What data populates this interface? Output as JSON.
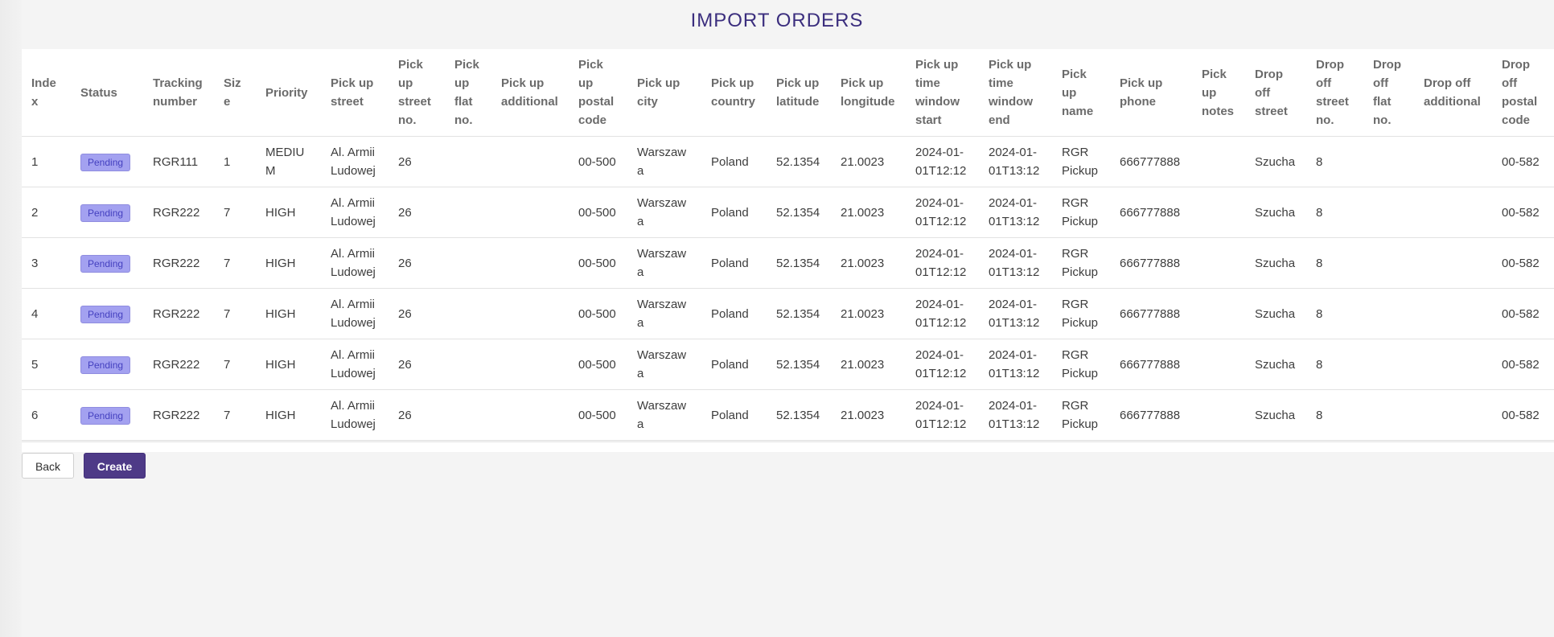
{
  "page": {
    "title": "IMPORT ORDERS"
  },
  "table": {
    "headers": [
      "Index",
      "Status",
      "Tracking number",
      "Size",
      "Priority",
      "Pick up street",
      "Pick up street no.",
      "Pick up flat no.",
      "Pick up additional",
      "Pick up postal code",
      "Pick up city",
      "Pick up country",
      "Pick up latitude",
      "Pick up longitude",
      "Pick up time window start",
      "Pick up time window end",
      "Pick up name",
      "Pick up phone",
      "Pick up notes",
      "Drop off street",
      "Drop off street no.",
      "Drop off flat no.",
      "Drop off additional",
      "Drop off postal code"
    ],
    "rows": [
      [
        "1",
        "Pending",
        "RGR111",
        "1",
        "MEDIUM",
        "Al. Armii Ludowej",
        "26",
        "",
        "",
        "00-500",
        "Warszawa",
        "Poland",
        "52.1354",
        "21.0023",
        "2024-01-01T12:12",
        "2024-01-01T13:12",
        "RGR Pickup",
        "666777888",
        "",
        "Szucha",
        "8",
        "",
        "",
        "00-582"
      ],
      [
        "2",
        "Pending",
        "RGR222",
        "7",
        "HIGH",
        "Al. Armii Ludowej",
        "26",
        "",
        "",
        "00-500",
        "Warszawa",
        "Poland",
        "52.1354",
        "21.0023",
        "2024-01-01T12:12",
        "2024-01-01T13:12",
        "RGR Pickup",
        "666777888",
        "",
        "Szucha",
        "8",
        "",
        "",
        "00-582"
      ],
      [
        "3",
        "Pending",
        "RGR222",
        "7",
        "HIGH",
        "Al. Armii Ludowej",
        "26",
        "",
        "",
        "00-500",
        "Warszawa",
        "Poland",
        "52.1354",
        "21.0023",
        "2024-01-01T12:12",
        "2024-01-01T13:12",
        "RGR Pickup",
        "666777888",
        "",
        "Szucha",
        "8",
        "",
        "",
        "00-582"
      ],
      [
        "4",
        "Pending",
        "RGR222",
        "7",
        "HIGH",
        "Al. Armii Ludowej",
        "26",
        "",
        "",
        "00-500",
        "Warszawa",
        "Poland",
        "52.1354",
        "21.0023",
        "2024-01-01T12:12",
        "2024-01-01T13:12",
        "RGR Pickup",
        "666777888",
        "",
        "Szucha",
        "8",
        "",
        "",
        "00-582"
      ],
      [
        "5",
        "Pending",
        "RGR222",
        "7",
        "HIGH",
        "Al. Armii Ludowej",
        "26",
        "",
        "",
        "00-500",
        "Warszawa",
        "Poland",
        "52.1354",
        "21.0023",
        "2024-01-01T12:12",
        "2024-01-01T13:12",
        "RGR Pickup",
        "666777888",
        "",
        "Szucha",
        "8",
        "",
        "",
        "00-582"
      ],
      [
        "6",
        "Pending",
        "RGR222",
        "7",
        "HIGH",
        "Al. Armii Ludowej",
        "26",
        "",
        "",
        "00-500",
        "Warszawa",
        "Poland",
        "52.1354",
        "21.0023",
        "2024-01-01T12:12",
        "2024-01-01T13:12",
        "RGR Pickup",
        "666777888",
        "",
        "Szucha",
        "8",
        "",
        "",
        "00-582"
      ]
    ]
  },
  "buttons": {
    "back_label": "Back",
    "create_label": "Create"
  },
  "colors": {
    "accent": "#4e3a87",
    "title": "#3b2e7e",
    "badge_bg": "#a3a1f0",
    "badge_text": "#4440c0"
  }
}
